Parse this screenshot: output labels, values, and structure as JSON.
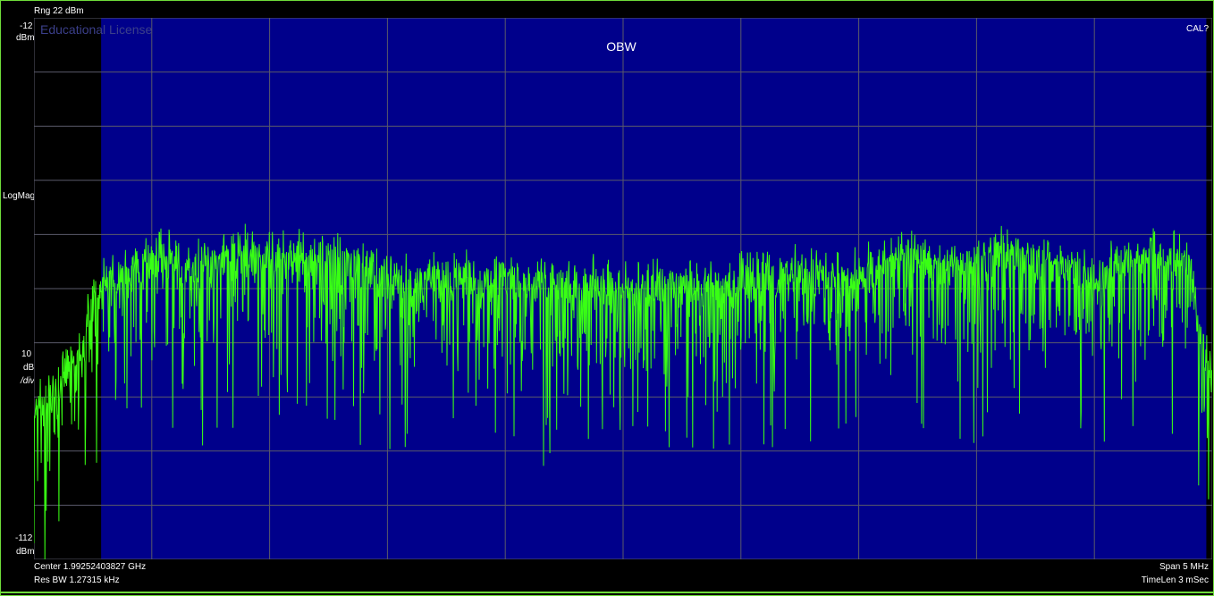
{
  "header": {
    "range_label": "Rng 22 dBm"
  },
  "y_axis": {
    "top_value": "-12",
    "top_unit": "dBm",
    "mode": "LogMag",
    "scale_value": "10",
    "scale_unit": "dB",
    "scale_per": "/div",
    "bottom_value": "-112",
    "bottom_unit": "dBm"
  },
  "plot": {
    "watermark": "Educational License",
    "title": "OBW",
    "cal_flag": "CAL?",
    "trace_color": "#39ff14",
    "obw_fill_color": "#00008b",
    "background_color": "#000000",
    "grid_color": "#5a5a6a"
  },
  "footer": {
    "center": "Center 1.99252403827 GHz",
    "res_bw": "Res BW 1.27315 kHz",
    "span": "Span 5 MHz",
    "time_len": "TimeLen 3 mSec"
  },
  "chart_data": {
    "type": "line",
    "title": "OBW",
    "y_unit": "dBm",
    "ylim": [
      -112,
      -12
    ],
    "y_scale_per_div": 10,
    "x_center_ghz": 1.99252403827,
    "x_span_mhz": 5,
    "xlim_mhz": [
      -2.5,
      2.5
    ],
    "grid": true,
    "obw_region_mhz": [
      -2.215,
      2.475
    ],
    "series": [
      {
        "x_mhz": [
          -2.5,
          -2.4,
          -2.3,
          -2.25,
          -2.2,
          -2.0,
          -1.8,
          -1.6,
          -1.4,
          -1.2,
          -1.0,
          -0.8,
          -0.6,
          -0.4,
          -0.2,
          0.0,
          0.2,
          0.4,
          0.6,
          0.8,
          1.0,
          1.2,
          1.4,
          1.6,
          1.8,
          2.0,
          2.2,
          2.4,
          2.45,
          2.5
        ],
        "y_dbm": [
          -82,
          -78,
          -72,
          -62,
          -58,
          -54,
          -56,
          -53,
          -55,
          -54,
          -58,
          -59,
          -58,
          -59,
          -59,
          -60,
          -59,
          -59,
          -58,
          -57,
          -58,
          -53,
          -56,
          -53,
          -55,
          -58,
          -54,
          -55,
          -68,
          -76
        ]
      }
    ]
  }
}
